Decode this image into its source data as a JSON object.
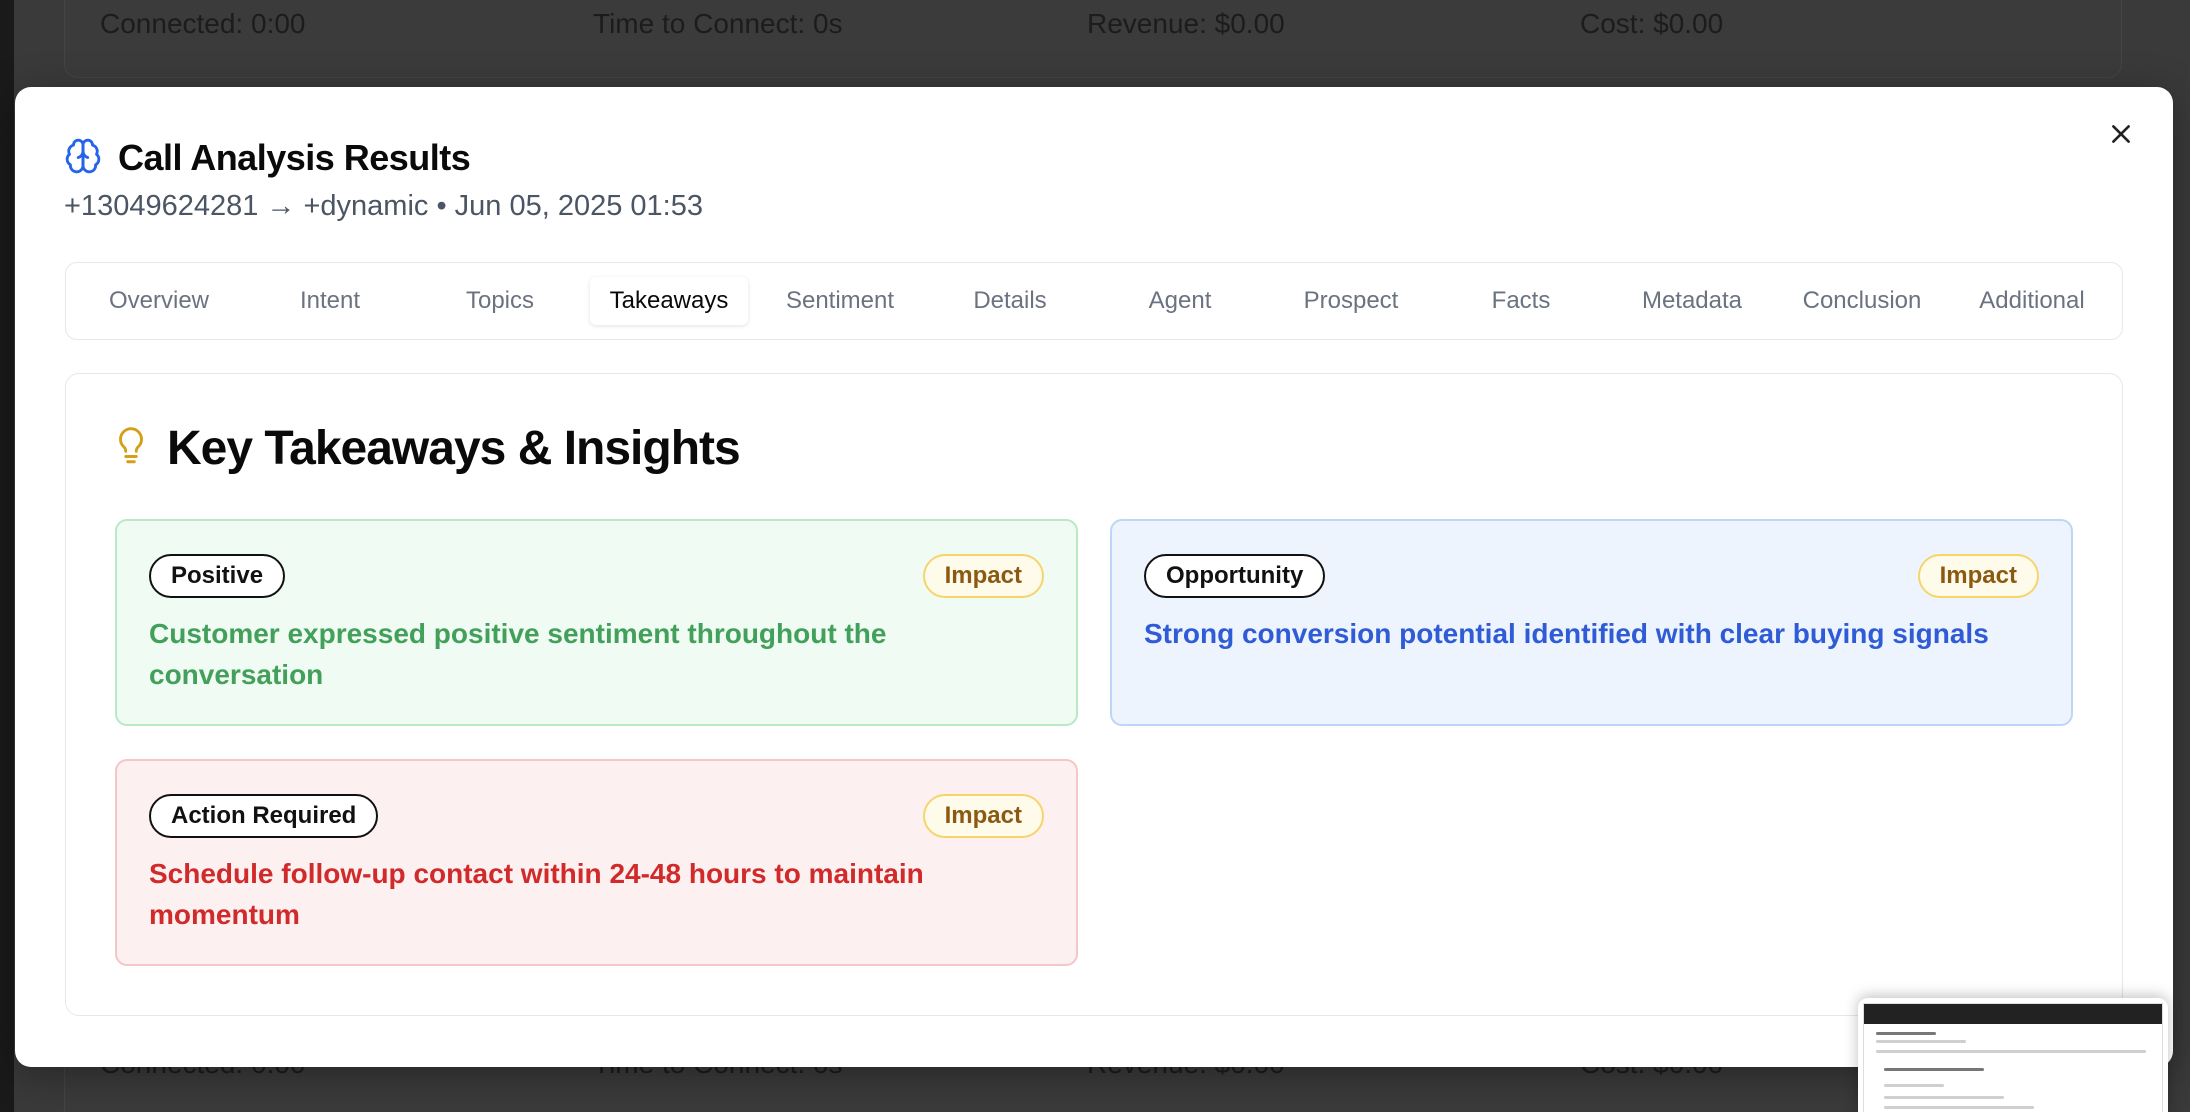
{
  "background": {
    "stats": [
      {
        "label": "Connected: 0:00"
      },
      {
        "label": "Time to Connect: 0s"
      },
      {
        "label": "Revenue: $0.00"
      },
      {
        "label": "Cost: $0.00"
      }
    ]
  },
  "modal": {
    "title": "Call Analysis Results",
    "title_icon": "brain-icon",
    "subtitle": "+13049624281 → +dynamic • Jun 05, 2025 01:53",
    "close_icon": "close-icon"
  },
  "tabs": [
    {
      "label": "Overview",
      "active": false
    },
    {
      "label": "Intent",
      "active": false
    },
    {
      "label": "Topics",
      "active": false
    },
    {
      "label": "Takeaways",
      "active": true
    },
    {
      "label": "Sentiment",
      "active": false
    },
    {
      "label": "Details",
      "active": false
    },
    {
      "label": "Agent",
      "active": false
    },
    {
      "label": "Prospect",
      "active": false
    },
    {
      "label": "Facts",
      "active": false
    },
    {
      "label": "Metadata",
      "active": false
    },
    {
      "label": "Conclusion",
      "active": false
    },
    {
      "label": "Additional",
      "active": false
    }
  ],
  "section": {
    "title": "Key Takeaways & Insights",
    "icon": "lightbulb-icon"
  },
  "insights": [
    {
      "type": "Positive",
      "impact": "Impact",
      "text": "Customer expressed positive sentiment throughout the conversation",
      "color": "#43a05a"
    },
    {
      "type": "Opportunity",
      "impact": "Impact",
      "text": "Strong conversion potential identified with clear buying signals",
      "color": "#2f5bd6"
    },
    {
      "type": "Action Required",
      "impact": "Impact",
      "text": "Schedule follow-up contact within 24-48 hours to maintain momentum",
      "color": "#d02a2a"
    }
  ],
  "colors": {
    "accent_blue": "#2563eb",
    "impact_gold": "#8a5a12",
    "lightbulb": "#d4a017"
  }
}
